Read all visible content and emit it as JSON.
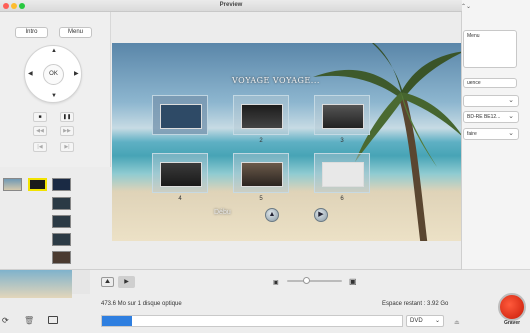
{
  "window": {
    "title": "Preview"
  },
  "buttons": {
    "intro": "Intro",
    "menu": "Menu",
    "ok": "OK"
  },
  "menu_screen": {
    "title": "VOYAGE VOYAGE...",
    "thumb_labels": [
      "",
      "2",
      "3",
      "4",
      "5",
      "6"
    ],
    "debut": "Débu"
  },
  "background_app": {
    "field_menu": "Menu",
    "field_sequence": "uence",
    "field_disc": "BD-RE BE12...",
    "field_action": "faire",
    "status_left": "473.6 Mo sur 1 disque optique",
    "status_right": "Espace restant : 3.92 Go",
    "disc_type": "DVD",
    "progress_fraction": 0.1,
    "burn_label": "Graver"
  },
  "colors": {
    "accent": "#2f7fe0",
    "burn": "#e0321a",
    "close": "#fe5f57",
    "minimize": "#febc2e",
    "zoom": "#28c840"
  }
}
